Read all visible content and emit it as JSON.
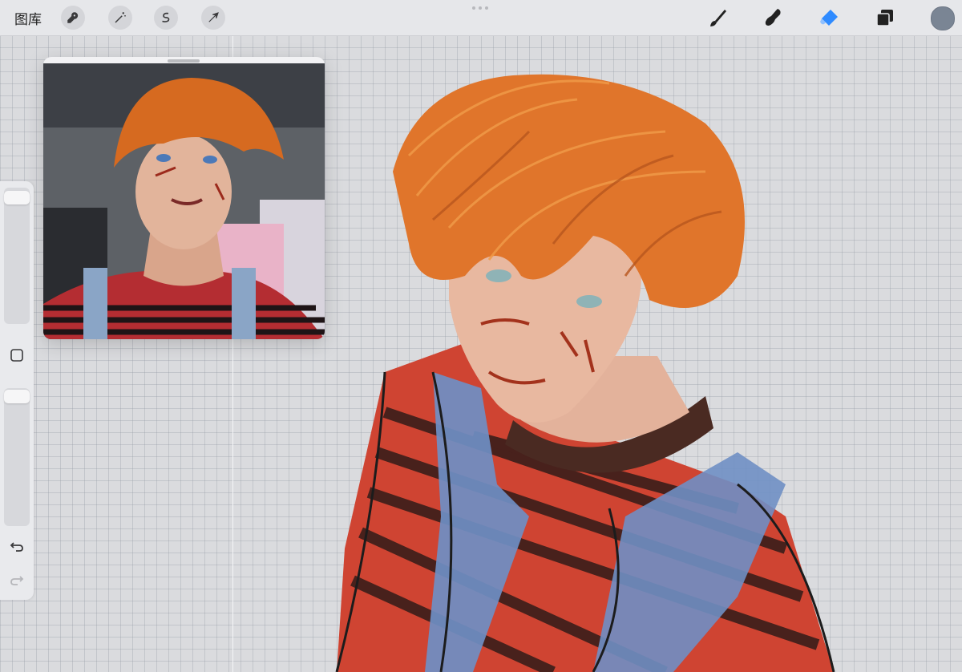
{
  "toolbar": {
    "gallery_label": "图库",
    "left_tools": [
      "wrench-icon",
      "magic-wand-icon",
      "selection-icon",
      "transform-arrow-icon"
    ],
    "right_tools": [
      "brush-icon",
      "smudge-icon",
      "eraser-icon",
      "layers-icon"
    ],
    "active_tool": "eraser-icon",
    "active_tool_color": "#2f8bff",
    "current_color": "#7a8594"
  },
  "reference": {
    "panel": "reference-window"
  },
  "sidebar": {
    "brush_size_slider": "brush-size",
    "opacity_slider": "brush-opacity",
    "modify_button": "square-icon",
    "undo": "undo-icon",
    "redo": "redo-icon"
  },
  "colors": {
    "hair": "#e0752b",
    "shirt_red": "#cf4432",
    "shirt_stripe": "#3a1e1a",
    "overalls": "#6f8fc4",
    "skin": "#e8b8a0"
  }
}
